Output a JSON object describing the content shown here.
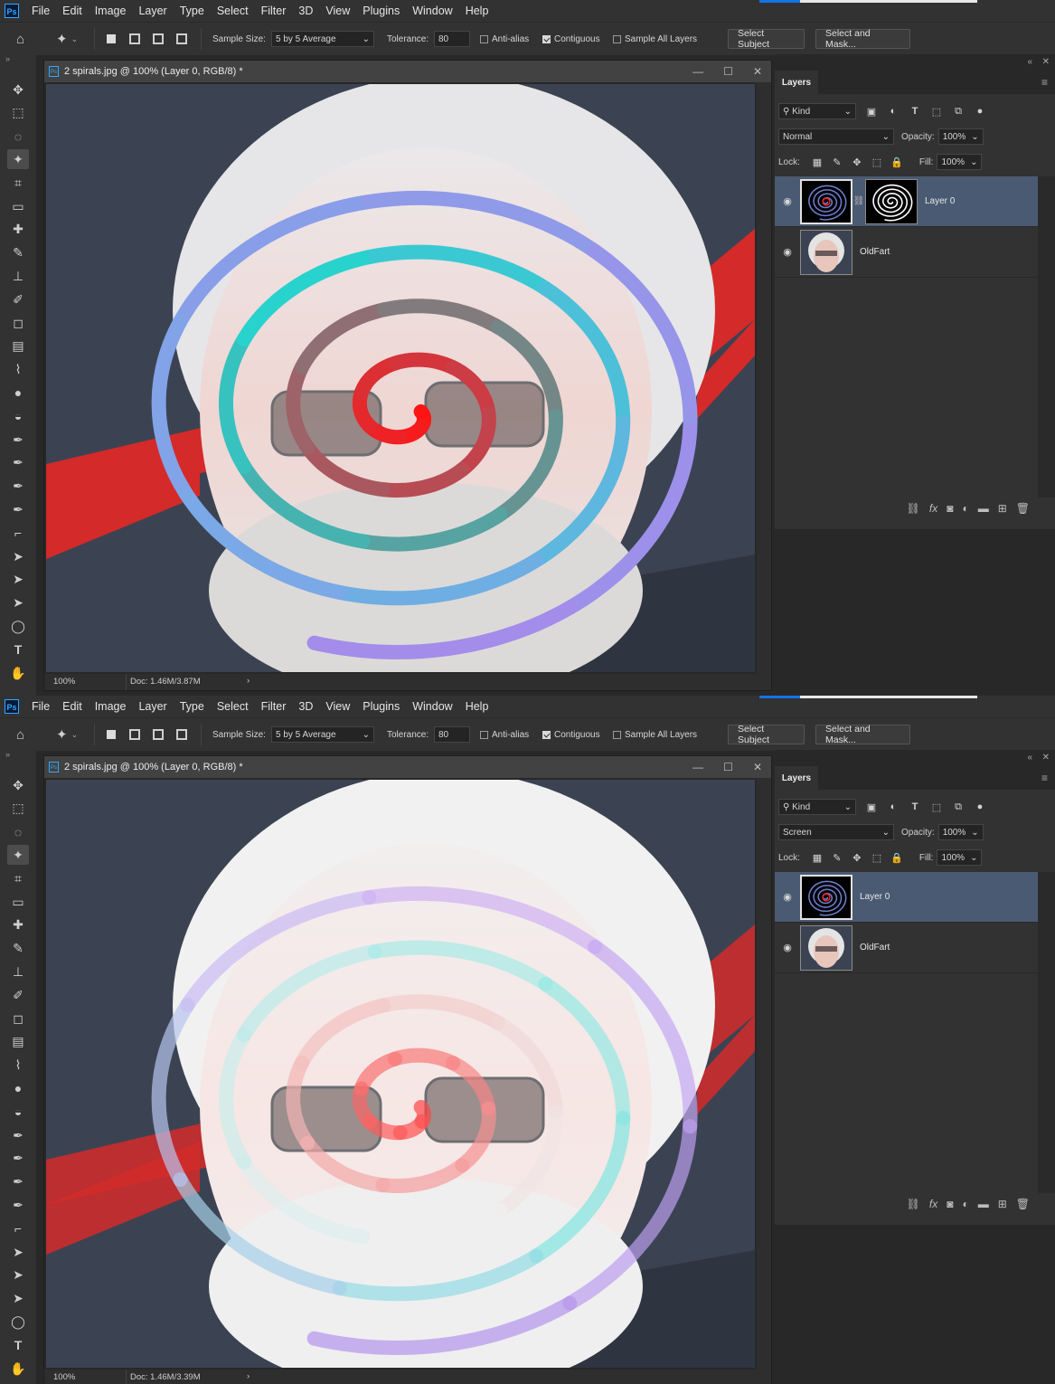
{
  "menu": [
    "File",
    "Edit",
    "Image",
    "Layer",
    "Type",
    "Select",
    "Filter",
    "3D",
    "View",
    "Plugins",
    "Window",
    "Help"
  ],
  "app_logo": "Ps",
  "options": {
    "sample_size_label": "Sample Size:",
    "sample_size_value": "5 by 5 Average",
    "tolerance_label": "Tolerance:",
    "tolerance_value": "80",
    "anti_alias": "Anti-alias",
    "contiguous": "Contiguous",
    "sample_all_layers": "Sample All Layers",
    "select_subject": "Select Subject",
    "select_and_mask": "Select and Mask..."
  },
  "panel": {
    "tab": "Layers",
    "kind": "Kind",
    "opacity_label": "Opacity:",
    "opacity_value": "100%",
    "lock_label": "Lock:",
    "fill_label": "Fill:",
    "fill_value": "100%"
  },
  "screens": [
    {
      "doc_title": "2 spirals.jpg @ 100% (Layer 0, RGB/8) *",
      "zoom": "100%",
      "doc_info": "Doc: 1.46M/3.87M",
      "blend_mode": "Normal",
      "layers": [
        {
          "name": "Layer 0",
          "selected": true,
          "has_mask": true
        },
        {
          "name": "OldFart",
          "selected": false,
          "has_mask": false
        }
      ]
    },
    {
      "doc_title": "2 spirals.jpg @ 100% (Layer 0, RGB/8) *",
      "zoom": "100%",
      "doc_info": "Doc: 1.46M/3.39M",
      "blend_mode": "Screen",
      "layers": [
        {
          "name": "Layer 0",
          "selected": true,
          "has_mask": false
        },
        {
          "name": "OldFart",
          "selected": false,
          "has_mask": false
        }
      ]
    }
  ],
  "icons": {
    "close": "✕",
    "minimize": "—",
    "maximize": "☐",
    "eye": "👁",
    "chevron": "⌄"
  },
  "colors": {
    "accent_blue": "#31a8ff",
    "selected_layer": "#4a5a72",
    "spiral_inner": "#ff1a1a",
    "spiral_mid": "#2ccfcf",
    "spiral_outer": "#a98be8"
  }
}
